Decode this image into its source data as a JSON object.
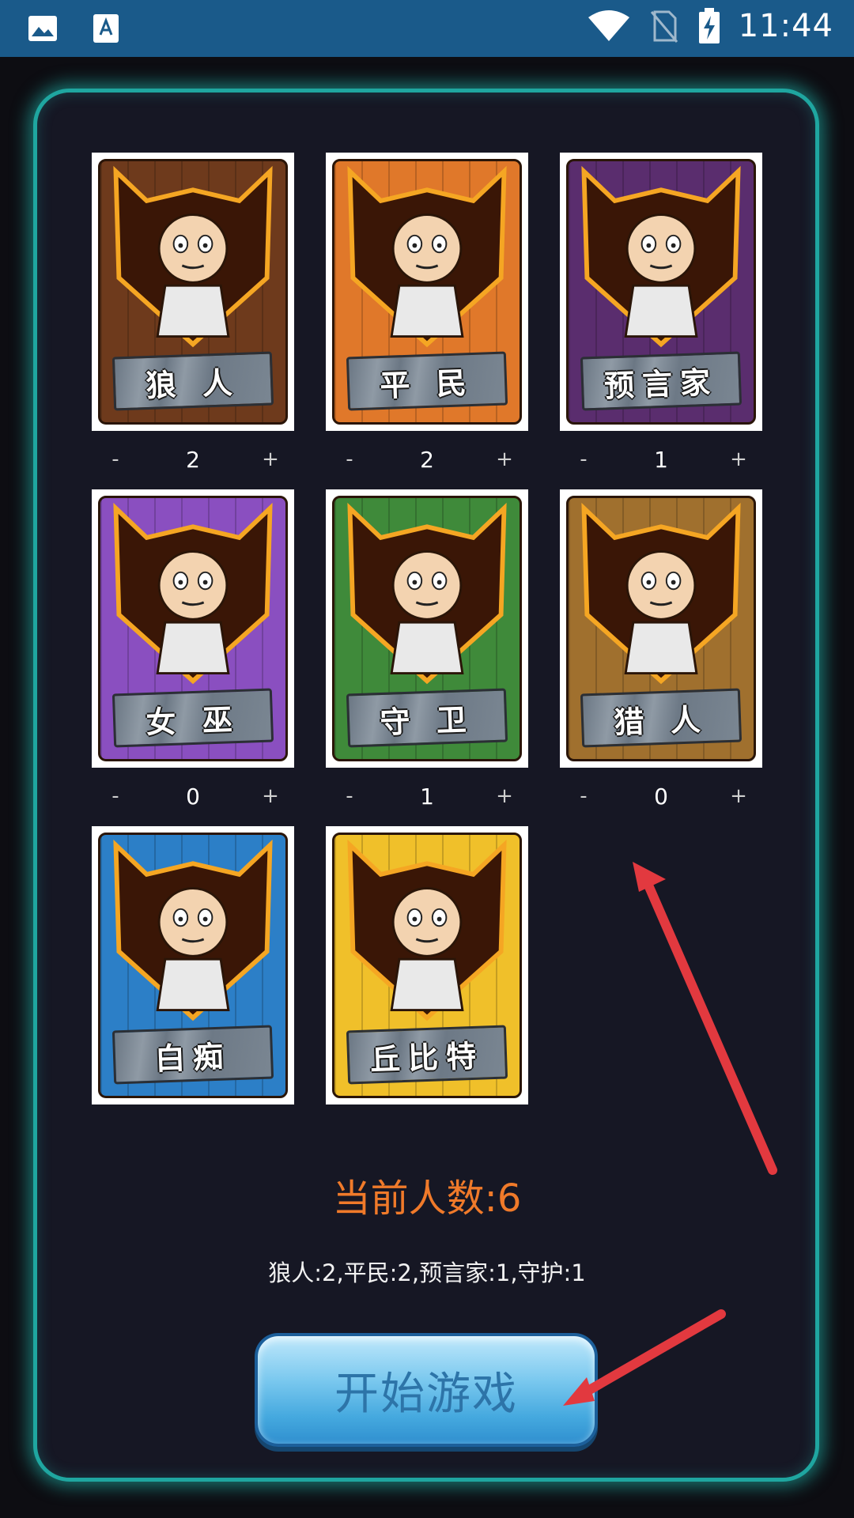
{
  "status_bar": {
    "time": "11:44",
    "icons": [
      "image-icon",
      "text-a-icon",
      "wifi-icon",
      "no-sim-icon",
      "battery-charging-icon"
    ]
  },
  "roles": [
    {
      "name": "狼 人",
      "count": "2",
      "color": "#6e3a1c",
      "minus": "-",
      "plus": "+"
    },
    {
      "name": "平 民",
      "count": "2",
      "color": "#e0782a",
      "minus": "-",
      "plus": "+"
    },
    {
      "name": "预言家",
      "count": "1",
      "color": "#5a2d6e",
      "minus": "-",
      "plus": "+"
    },
    {
      "name": "女 巫",
      "count": "0",
      "color": "#8a4fc0",
      "minus": "-",
      "plus": "+"
    },
    {
      "name": "守 卫",
      "count": "1",
      "color": "#3f8a3a",
      "minus": "-",
      "plus": "+"
    },
    {
      "name": "猎 人",
      "count": "0",
      "color": "#a0702e",
      "minus": "-",
      "plus": "+"
    },
    {
      "name": "白痴",
      "color": "#2c7fc7"
    },
    {
      "name": "丘比特",
      "color": "#f0c02a"
    }
  ],
  "current_count_label": "当前人数:6",
  "summary": "狼人:2,平民:2,预言家:1,守护:1",
  "start_button": "开始游戏",
  "colors": {
    "accent_orange": "#f07a2a",
    "panel_border": "#1fa6a0",
    "arrow_red": "#e2393f"
  }
}
